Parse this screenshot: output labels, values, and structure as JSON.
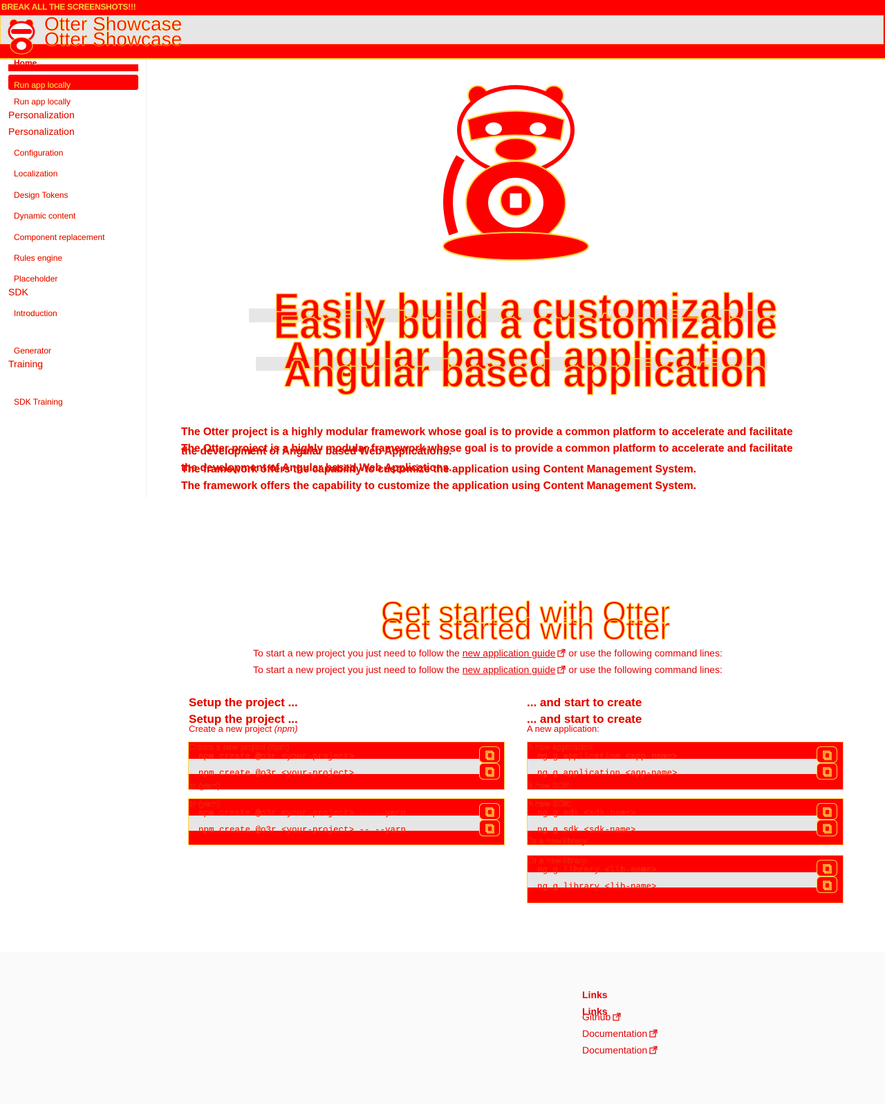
{
  "banner": {
    "text": "BREAK ALL THE SCREENSHOTS!!!"
  },
  "header": {
    "title": "Otter Showcase"
  },
  "sidebar": {
    "home": "Home",
    "run_app": "Run app locally",
    "personalization": "Personalization",
    "personalization_items": [
      "Configuration",
      "Localization",
      "Design Tokens",
      "Dynamic content",
      "Component replacement",
      "Rules engine",
      "Placeholder"
    ],
    "sdk": "SDK",
    "sdk_items": [
      "Introduction",
      "Generator"
    ],
    "training": "Training",
    "training_items": [
      "SDK Training"
    ]
  },
  "hero": {
    "title_line1": "Easily build a customizable",
    "title_line2": "Angular based application",
    "paragraph_line1": "The Otter project is a highly modular framework whose goal is to provide a common platform to accelerate and facilitate",
    "paragraph_line2": "the development of Angular based Web Applications.",
    "paragraph_line3": "The framework offers the capability to customize the application using Content Management System."
  },
  "get_started": {
    "title": "Get started with Otter",
    "intro_before": "To start a new project you just need to follow the",
    "intro_link": "new application guide",
    "intro_after": "or use the following command lines:",
    "setup": {
      "title": "Setup the project ...",
      "subtitle_prefix": "Create a new project",
      "subtitle_em": "(npm)",
      "npm_label": "Create a new project (npm)",
      "npm_command": "npm create @o3r <your-project>",
      "yarn_label": "or (yarn)",
      "yarn_command": "npm create @o3r <your-project> -- --yarn"
    },
    "create": {
      "title": "... and start to create",
      "subtitle": "A new application:",
      "app_label": "A new application:",
      "app_command": "ng g application <app-name>",
      "sdk_label": "A new SDK:",
      "sdk_command": "ng g sdk <sdk-name>",
      "lib_label": "Or a new library:",
      "lib_command": "ng g library <lib-name>"
    }
  },
  "footer": {
    "links_title": "Links",
    "github": "Github",
    "documentation": "Documentation"
  },
  "colors": {
    "primary": "#ff0000",
    "accent": "#ffd23f",
    "band": "#e6e6e6"
  }
}
